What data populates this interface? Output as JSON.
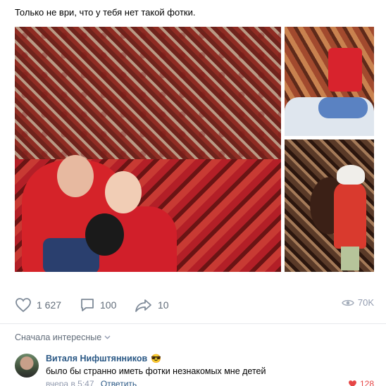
{
  "post": {
    "text": "Только не ври, что у тебя нет такой фотки."
  },
  "actions": {
    "likes": "1 627",
    "comments": "100",
    "shares": "10",
    "views": "70K"
  },
  "comments_section": {
    "sort_label": "Сначала интересные",
    "items": [
      {
        "author": "Виталя Нифштянников",
        "author_emoji": "😎",
        "text": "было бы странно иметь фотки незнакомых мне детей",
        "time": "вчера в 5:47",
        "reply_label": "Ответить",
        "likes": "128"
      }
    ]
  },
  "colors": {
    "accent_link": "#2a5885",
    "icon_gray": "#626d7a",
    "like_red": "#e64646"
  }
}
